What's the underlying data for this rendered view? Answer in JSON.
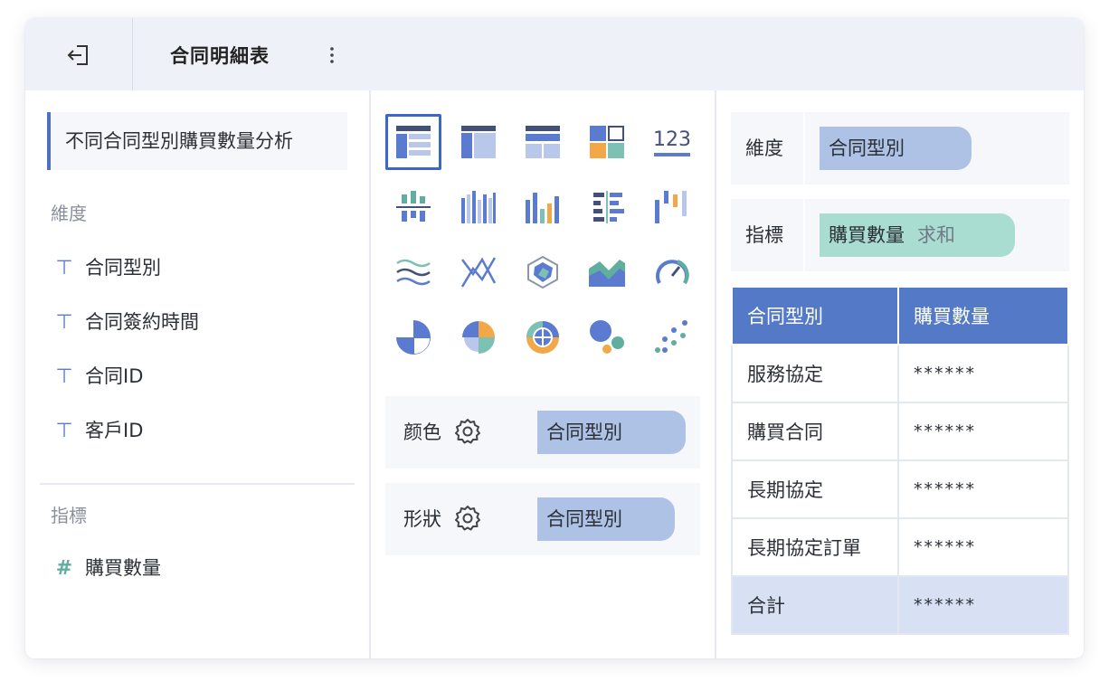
{
  "header": {
    "title": "合同明細表"
  },
  "left_panel": {
    "chart_name": "不同合同型別購買數量分析",
    "dimension_title": "維度",
    "dimensions": [
      "合同型別",
      "合同簽約時間",
      "合同ID",
      "客戶ID"
    ],
    "metric_title": "指標",
    "metrics": [
      "購買數量"
    ]
  },
  "chart_types": {
    "row1": [
      "table-icon",
      "cross-table-icon",
      "detail-table-icon",
      "layout-icon",
      "number-card-icon"
    ],
    "row2": [
      "stacked-bar-icon",
      "grouped-bar-icon",
      "column-icon",
      "horizontal-bar-icon",
      "waterfall-icon"
    ],
    "row3": [
      "line-wave-icon",
      "line-icon",
      "radar-icon",
      "area-icon",
      "gauge-icon"
    ],
    "row4": [
      "pie-icon",
      "rose-pie-icon",
      "sunburst-icon",
      "bubble-icon",
      "scatter-icon"
    ],
    "number_card_text": "123"
  },
  "mappings": {
    "color": {
      "label": "颜色",
      "value": "合同型別"
    },
    "shape": {
      "label": "形狀",
      "value": "合同型別"
    }
  },
  "config": {
    "dimension_label": "維度",
    "dimension_value": "合同型別",
    "metric_label": "指標",
    "metric_value": "購買數量",
    "metric_agg": "求和"
  },
  "table": {
    "headers": [
      "合同型別",
      "購買數量"
    ],
    "rows": [
      [
        "服務協定",
        "******"
      ],
      [
        "購買合同",
        "******"
      ],
      [
        "長期協定",
        "******"
      ],
      [
        "長期協定訂單",
        "******"
      ]
    ],
    "total": [
      "合計",
      "******"
    ]
  },
  "colors": {
    "accent": "#3d66cc",
    "header_blue": "#5479c6",
    "pill_blue": "#aec2e6",
    "pill_green": "#a9ddd2",
    "teal": "#5fae9f",
    "orange": "#f0a848"
  }
}
